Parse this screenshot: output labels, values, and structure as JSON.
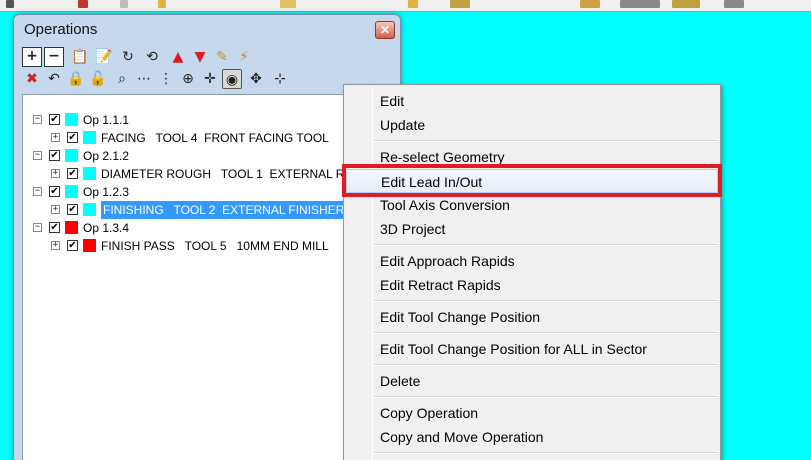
{
  "colors": {
    "background": "#00ffff",
    "selection": "#3399ff",
    "highlight_box": "#e31b23",
    "cyan_swatch": "#00ffff",
    "red_swatch": "#ff0000"
  },
  "window": {
    "title": "Operations",
    "close_label": "✕"
  },
  "toolbar": {
    "row1": [
      {
        "name": "expand-all-icon",
        "glyph": "+"
      },
      {
        "name": "collapse-all-icon",
        "glyph": "−"
      },
      {
        "name": "clipboard-icon",
        "glyph": "📋"
      },
      {
        "name": "notepad-icon",
        "glyph": "📝"
      },
      {
        "name": "renumber-icon",
        "glyph": "↻"
      },
      {
        "name": "renumber-alt-icon",
        "glyph": "⟲"
      },
      {
        "name": "move-up-icon",
        "glyph": "▲"
      },
      {
        "name": "move-down-icon",
        "glyph": "▼"
      },
      {
        "name": "pencil-icon",
        "glyph": "✎"
      },
      {
        "name": "lightning-icon",
        "glyph": "⚡"
      }
    ],
    "row2": [
      {
        "name": "delete-icon",
        "glyph": "✖"
      },
      {
        "name": "undo-icon",
        "glyph": "↶"
      },
      {
        "name": "lock-icon",
        "glyph": "🔒"
      },
      {
        "name": "lock-open-icon",
        "glyph": "🔓"
      },
      {
        "name": "binoculars-icon",
        "glyph": "⌕"
      },
      {
        "name": "toolpath-icon",
        "glyph": "⋯"
      },
      {
        "name": "toolpath-alt-icon",
        "glyph": "⋮"
      },
      {
        "name": "insert-icon",
        "glyph": "⊕"
      },
      {
        "name": "cross-icon",
        "glyph": "✛"
      },
      {
        "name": "target-icon",
        "glyph": "◉"
      },
      {
        "name": "vertical-marker-icon",
        "glyph": "✥"
      },
      {
        "name": "horizontal-marker-icon",
        "glyph": "⊹"
      }
    ]
  },
  "tree": [
    {
      "label": "Op 1.1.1",
      "level": 0,
      "swatch": "#00ffff",
      "checked": true,
      "selected": false
    },
    {
      "label": "FACING   TOOL 4  FRONT FACING TOOL",
      "level": 1,
      "swatch": "#00ffff",
      "checked": true,
      "selected": false
    },
    {
      "label": "Op 2.1.2",
      "level": 0,
      "swatch": "#00ffff",
      "checked": true,
      "selected": false
    },
    {
      "label": "DIAMETER ROUGH   TOOL 1  EXTERNAL R",
      "level": 1,
      "swatch": "#00ffff",
      "checked": true,
      "selected": false
    },
    {
      "label": "Op 1.2.3",
      "level": 0,
      "swatch": "#00ffff",
      "checked": true,
      "selected": false
    },
    {
      "label": "FINISHING   TOOL 2  EXTERNAL FINISHER",
      "level": 1,
      "swatch": "#00ffff",
      "checked": true,
      "selected": true
    },
    {
      "label": "Op 1.3.4",
      "level": 0,
      "swatch": "#ff0000",
      "checked": true,
      "selected": false
    },
    {
      "label": "FINISH PASS   TOOL 5   10MM END MILL",
      "level": 1,
      "swatch": "#ff0000",
      "checked": true,
      "selected": false
    }
  ],
  "context_menu": {
    "items": [
      {
        "label": "Edit",
        "name": "menu-edit"
      },
      {
        "label": "Update",
        "name": "menu-update"
      },
      {
        "sep": true
      },
      {
        "label": "Re-select Geometry",
        "name": "menu-reselect-geometry"
      },
      {
        "label": "Edit Lead In/Out",
        "name": "menu-edit-lead-in-out",
        "hover": true
      },
      {
        "label": "Tool Axis Conversion",
        "name": "menu-tool-axis-conversion"
      },
      {
        "label": "3D Project",
        "name": "menu-3d-project"
      },
      {
        "sep": true
      },
      {
        "label": "Edit Approach Rapids",
        "name": "menu-edit-approach-rapids"
      },
      {
        "label": "Edit Retract Rapids",
        "name": "menu-edit-retract-rapids"
      },
      {
        "sep": true
      },
      {
        "label": "Edit Tool Change Position",
        "name": "menu-edit-tool-change-position"
      },
      {
        "sep": true
      },
      {
        "label": "Edit Tool Change Position for ALL in Sector",
        "name": "menu-edit-tool-change-position-all"
      },
      {
        "sep": true
      },
      {
        "label": "Delete",
        "name": "menu-delete"
      },
      {
        "sep": true
      },
      {
        "label": "Copy Operation",
        "name": "menu-copy-operation"
      },
      {
        "label": "Copy and Move Operation",
        "name": "menu-copy-move-operation"
      },
      {
        "sep": true
      }
    ]
  }
}
